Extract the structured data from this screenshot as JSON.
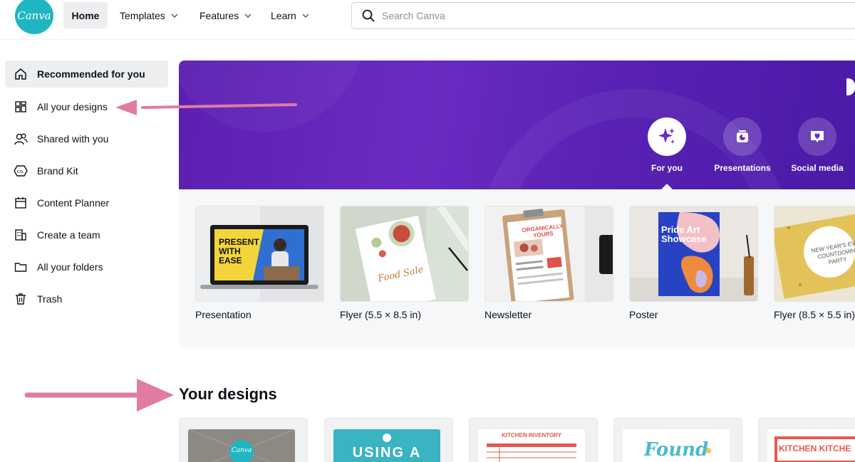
{
  "header": {
    "logo_text": "Canva",
    "nav": {
      "home": "Home",
      "templates": "Templates",
      "features": "Features",
      "learn": "Learn"
    },
    "search_placeholder": "Search Canva"
  },
  "sidebar": {
    "items": [
      {
        "label": "Recommended for you",
        "icon": "home-icon"
      },
      {
        "label": "All your designs",
        "icon": "grid-icon"
      },
      {
        "label": "Shared with you",
        "icon": "people-icon"
      },
      {
        "label": "Brand Kit",
        "icon": "brand-kit-icon"
      },
      {
        "label": "Content Planner",
        "icon": "calendar-icon"
      },
      {
        "label": "Create a team",
        "icon": "building-icon"
      },
      {
        "label": "All your folders",
        "icon": "folder-icon"
      },
      {
        "label": "Trash",
        "icon": "trash-icon"
      }
    ]
  },
  "banner": {
    "categories": [
      {
        "label": "For you",
        "icon": "sparkle-icon"
      },
      {
        "label": "Presentations",
        "icon": "presentation-icon"
      },
      {
        "label": "Social media",
        "icon": "heart-chat-icon"
      }
    ]
  },
  "templates": {
    "items": [
      {
        "label": "Presentation",
        "thumb_text": "PRESENT WITH EASE"
      },
      {
        "label": "Flyer (5.5 × 8.5 in)",
        "thumb_text": "Food Sale"
      },
      {
        "label": "Newsletter",
        "thumb_text": "ORGANICALLY YOURS"
      },
      {
        "label": "Poster",
        "thumb_text": "Pride Art Showcase"
      },
      {
        "label": "Flyer (8.5 × 5.5 in)",
        "thumb_text": "NEW YEAR'S EVE COUNTDOWN PARTY"
      }
    ]
  },
  "designs": {
    "title": "Your designs",
    "items": [
      {
        "thumb_text": "Canva"
      },
      {
        "thumb_text": "USING A"
      },
      {
        "thumb_text": "KITCHEN INVENTORY"
      },
      {
        "thumb_text": "Found"
      },
      {
        "thumb_text": "KITCHEN KITCHE"
      }
    ]
  },
  "colors": {
    "brand": "#1fb6c1",
    "banner_purple": "#5b1fb0",
    "annotation_pink": "#e07ba1"
  }
}
